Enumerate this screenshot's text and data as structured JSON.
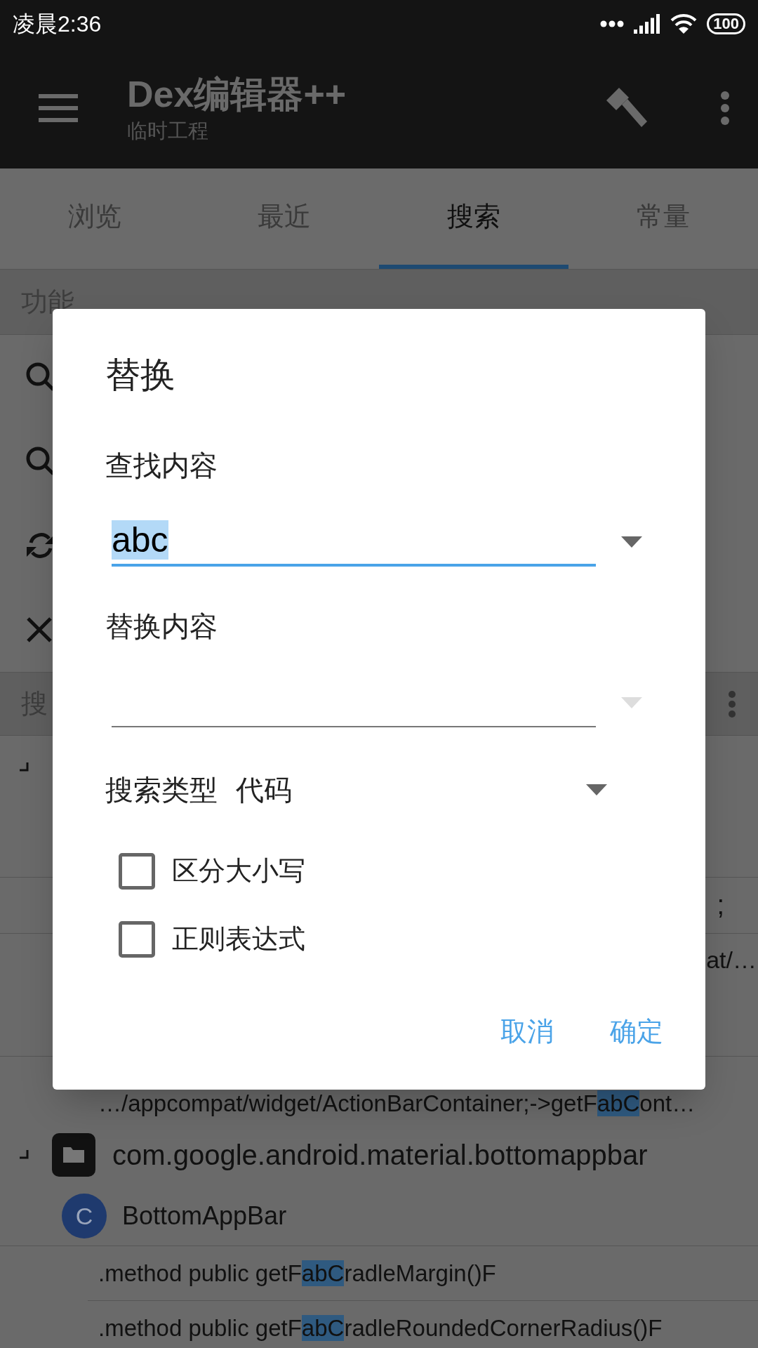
{
  "status_bar": {
    "time": "凌晨2:36",
    "battery": "100"
  },
  "app_bar": {
    "title": "Dex编辑器++",
    "subtitle": "临时工程"
  },
  "tabs": [
    {
      "label": "浏览",
      "selected": false
    },
    {
      "label": "最近",
      "selected": false
    },
    {
      "label": "搜索",
      "selected": true
    },
    {
      "label": "常量",
      "selected": false
    }
  ],
  "functions": {
    "header": "功能",
    "items": [
      {
        "kind": "search"
      },
      {
        "kind": "search"
      },
      {
        "kind": "replace"
      },
      {
        "kind": "clear"
      }
    ]
  },
  "results": {
    "header": "搜",
    "fragments": [
      ";",
      "at/…"
    ],
    "partial_line": {
      "before": "…/appcompat/widget/ActionBarContainer;->getF",
      "match": "abC",
      "after": "ont…"
    },
    "package": "com.google.android.material.bottomappbar",
    "class": {
      "badge": "C",
      "name": "BottomAppBar"
    },
    "methods": [
      {
        "before": ".method public getF",
        "match": "abC",
        "after": "radleMargin()F"
      },
      {
        "before": ".method public getF",
        "match": "abC",
        "after": "radleRoundedCornerRadius()F"
      }
    ]
  },
  "dialog": {
    "title": "替换",
    "find": {
      "label": "查找内容",
      "value": "abc",
      "focused": true
    },
    "replace": {
      "label": "替换内容",
      "focused": false
    },
    "search_type": {
      "label": "搜索类型",
      "value": "代码"
    },
    "options": [
      {
        "label": "区分大小写",
        "checked": false
      },
      {
        "label": "正则表达式",
        "checked": false
      }
    ],
    "buttons": [
      "取消",
      "确定"
    ]
  }
}
